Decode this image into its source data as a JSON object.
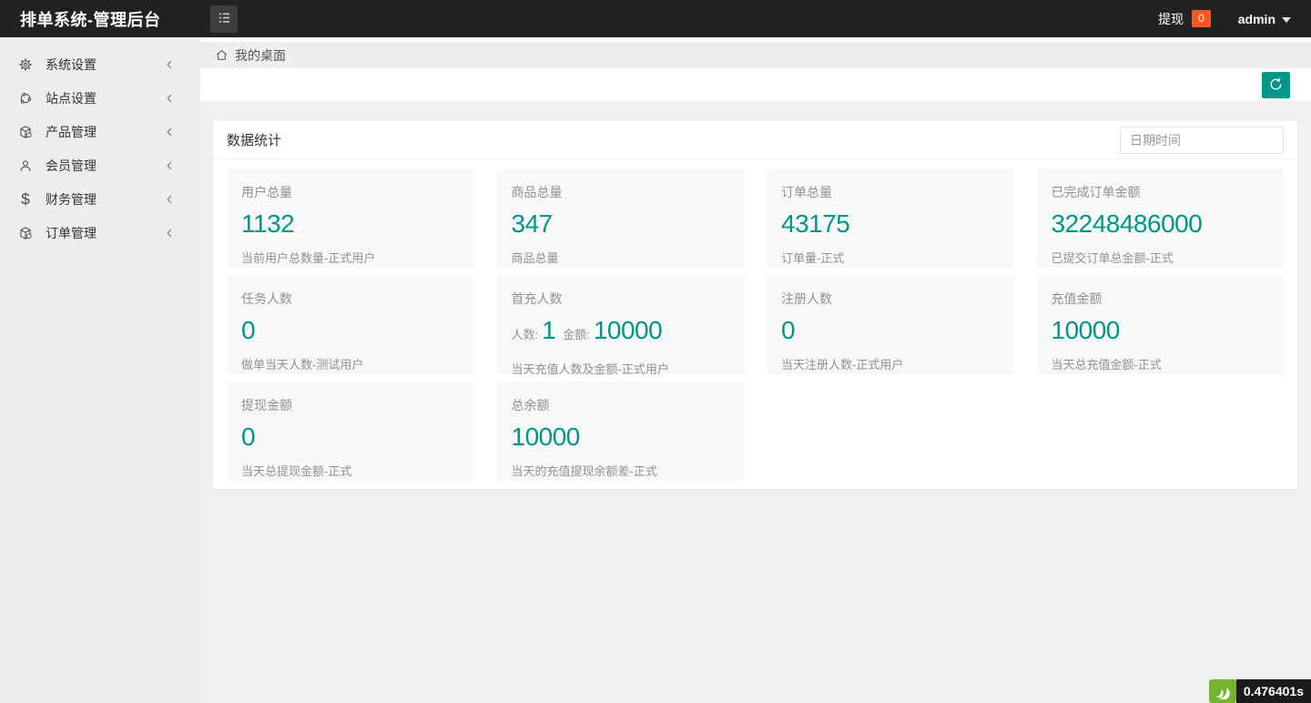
{
  "header": {
    "title": "排单系统-管理后台",
    "withdraw_label": "提现",
    "withdraw_badge": "0",
    "username": "admin",
    "icons": {
      "toggle": "list-menu-icon",
      "caret": "caret-down-icon"
    }
  },
  "sidebar": {
    "items": [
      {
        "label": "系统设置",
        "icon": "gear-icon"
      },
      {
        "label": "站点设置",
        "icon": "site-globe-icon"
      },
      {
        "label": "产品管理",
        "icon": "cube-icon"
      },
      {
        "label": "会员管理",
        "icon": "user-icon"
      },
      {
        "label": "财务管理",
        "icon": "dollar-icon"
      },
      {
        "label": "订单管理",
        "icon": "cube-icon"
      }
    ],
    "dollar_glyph": "$",
    "chevron": "chevron-left-icon"
  },
  "breadcrumb": {
    "label": "我的桌面",
    "icon": "home-icon"
  },
  "tabbar": {
    "refresh_icon": "refresh-icon"
  },
  "panel": {
    "title": "数据统计",
    "date_placeholder": "日期时间"
  },
  "stats": {
    "cards": [
      {
        "title": "用户总量",
        "value": "1132",
        "desc": "当前用户总数量-正式用户"
      },
      {
        "title": "商品总量",
        "value": "347",
        "desc": "商品总量"
      },
      {
        "title": "订单总量",
        "value": "43175",
        "desc": "订单量-正式"
      },
      {
        "title": "已完成订单金额",
        "value": "32248486000",
        "desc": "已提交订单总金额-正式"
      },
      {
        "title": "任务人数",
        "value": "0",
        "desc": "做单当天人数-测试用户"
      },
      {
        "title": "首充人数",
        "count_label": "人数:",
        "count_value": "1",
        "amount_label": "金额:",
        "amount_value": "10000",
        "desc": "当天充值人数及金额-正式用户"
      },
      {
        "title": "注册人数",
        "value": "0",
        "desc": "当天注册人数-正式用户"
      },
      {
        "title": "充值金额",
        "value": "10000",
        "desc": "当天总充值金额-正式"
      },
      {
        "title": "提现金额",
        "value": "0",
        "desc": "当天总提现金额-正式"
      },
      {
        "title": "总余额",
        "value": "10000",
        "desc": "当天的充值提现余额差-正式"
      }
    ]
  },
  "trace": {
    "time": "0.476401s",
    "logo": "thinkphp-logo-icon"
  },
  "colors": {
    "accent": "#009688",
    "badge": "#FF5722",
    "header_bg": "#222222",
    "logo_green": "#74b42e",
    "card_bg": "#f8f8f8"
  }
}
